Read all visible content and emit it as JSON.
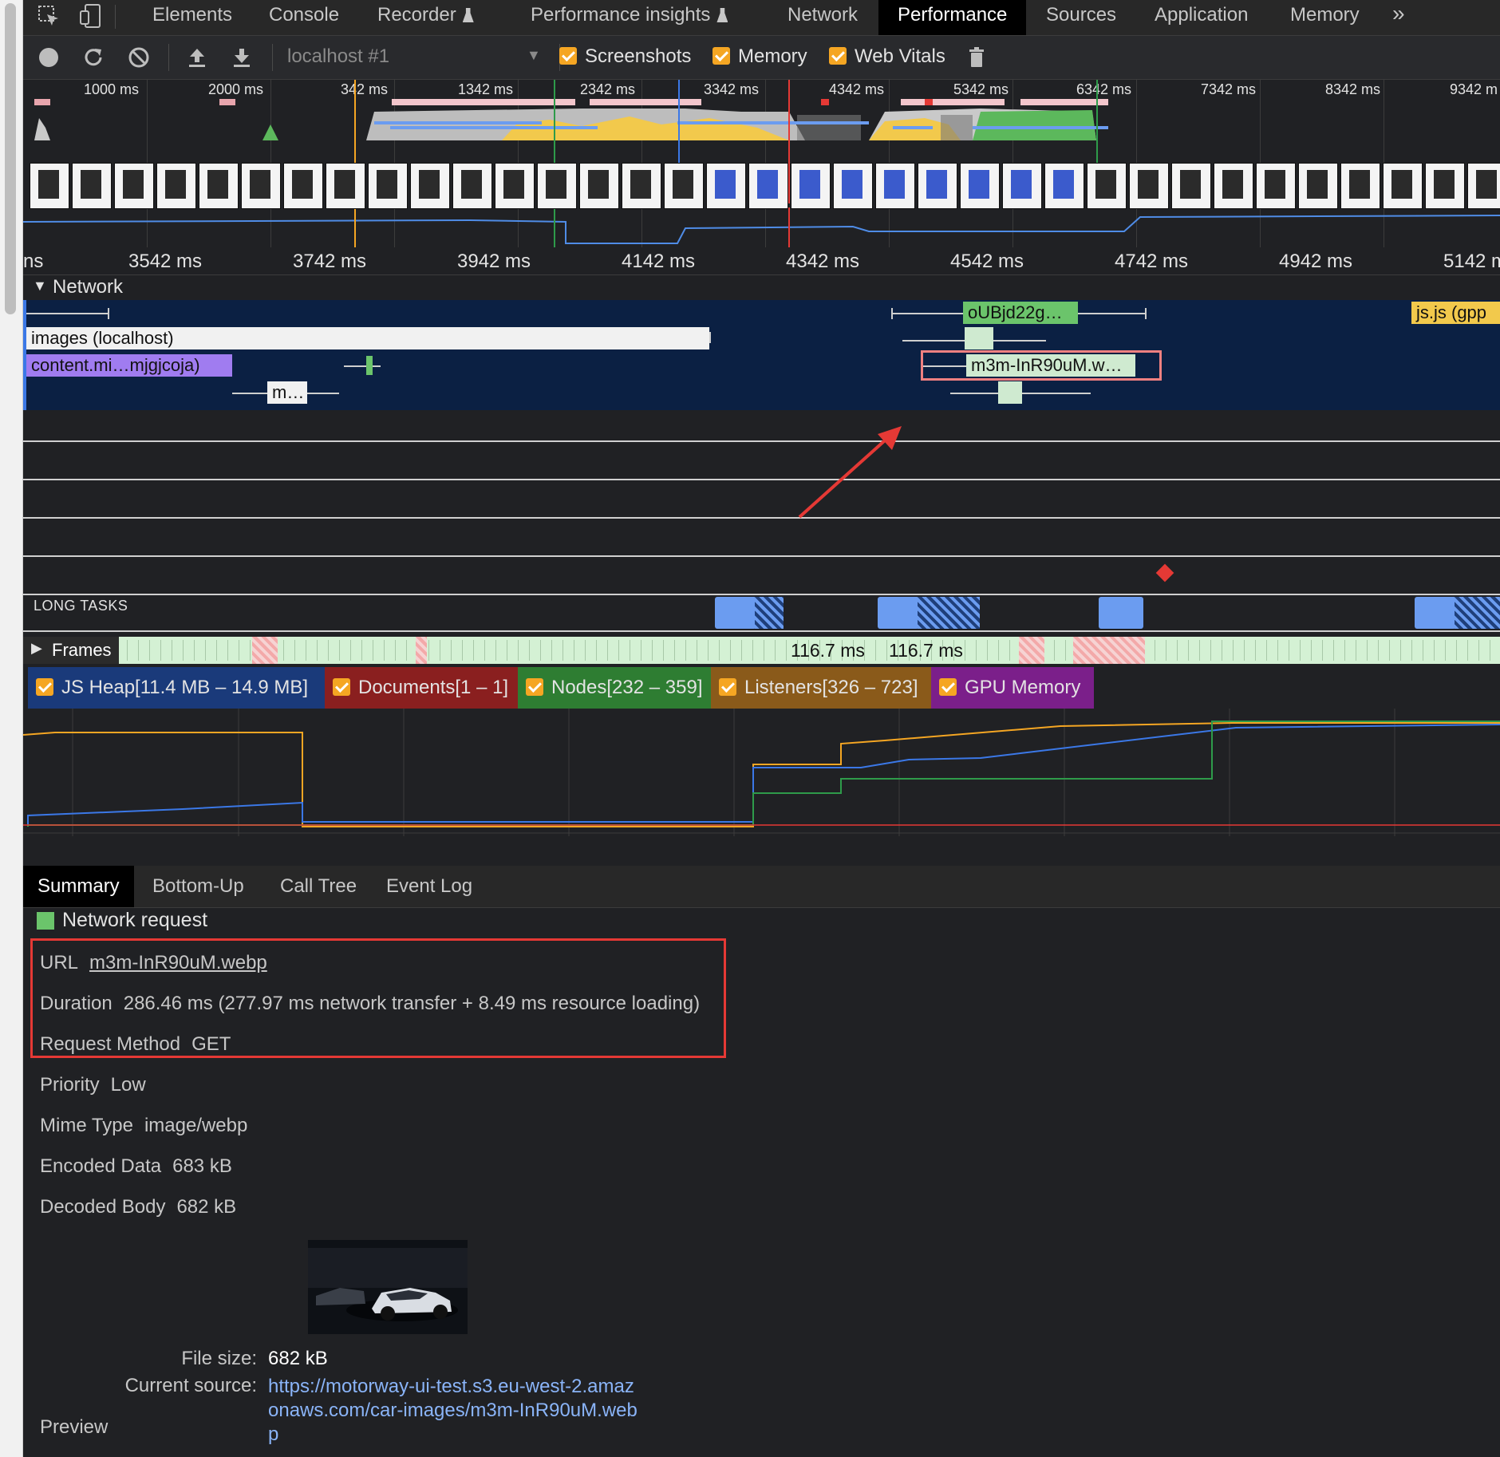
{
  "tabs": {
    "items": [
      "Elements",
      "Console",
      "Recorder",
      "Performance insights",
      "Network",
      "Performance",
      "Sources",
      "Application",
      "Memory"
    ],
    "more": "»"
  },
  "toolbar": {
    "target": "localhost #1",
    "screenshots": "Screenshots",
    "memory": "Memory",
    "web_vitals": "Web Vitals"
  },
  "overview": {
    "ticks": [
      "1000 ms",
      "2000 ms",
      "342 ms",
      "1342 ms",
      "2342 ms",
      "3342 ms",
      "4342 ms",
      "5342 ms",
      "6342 ms",
      "7342 ms",
      "8342 ms",
      "9342 m"
    ]
  },
  "ruler": {
    "ticks": [
      "ns",
      "3542 ms",
      "3742 ms",
      "3942 ms",
      "4142 ms",
      "4342 ms",
      "4542 ms",
      "4742 ms",
      "4942 ms",
      "5142 m"
    ]
  },
  "network": {
    "title": "Network",
    "requests": [
      "oUBjd22g…",
      "js.js (gpp",
      "images (localhost)",
      "content.mi…mjgjcoja)",
      "m3m-InR90uM.w…",
      "m…"
    ]
  },
  "long_tasks": "LONG TASKS",
  "frames": {
    "label": "Frames",
    "durations": [
      "116.7 ms",
      "116.7 ms"
    ]
  },
  "memory_legend": [
    {
      "label": "JS Heap[11.4 MB – 14.9 MB]",
      "color": "#1a3a7a"
    },
    {
      "label": "Documents[1 – 1]",
      "color": "#8a1f1f"
    },
    {
      "label": "Nodes[232 – 359]",
      "color": "#2e7d32"
    },
    {
      "label": "Listeners[326 – 723]",
      "color": "#8a5a1a"
    },
    {
      "label": "GPU Memory",
      "color": "#7b1f8a"
    }
  ],
  "bottom_tabs": [
    "Summary",
    "Bottom-Up",
    "Call Tree",
    "Event Log"
  ],
  "summary": {
    "title": "Network request",
    "url_label": "URL",
    "url": "m3m-InR90uM.webp",
    "duration_label": "Duration",
    "duration": "286.46 ms (277.97 ms network transfer + 8.49 ms resource loading)",
    "method_label": "Request Method",
    "method": "GET",
    "priority_label": "Priority",
    "priority": "Low",
    "mime_label": "Mime Type",
    "mime": "image/webp",
    "encoded_label": "Encoded Data",
    "encoded": "683 kB",
    "decoded_label": "Decoded Body",
    "decoded": "682 kB",
    "preview_label": "Preview",
    "file_size_label": "File size:",
    "file_size": "682 kB",
    "source_label": "Current source:",
    "source_lines": [
      "https://motorway-ui-test.s3.eu-west-2.amaz",
      "onaws.com/car-images/m3m-InR90uM.web",
      "p"
    ]
  },
  "colors": {
    "accent_checkbox": "#f5a623",
    "annotation_red": "#e53935",
    "network_bg": "#0b2043"
  }
}
